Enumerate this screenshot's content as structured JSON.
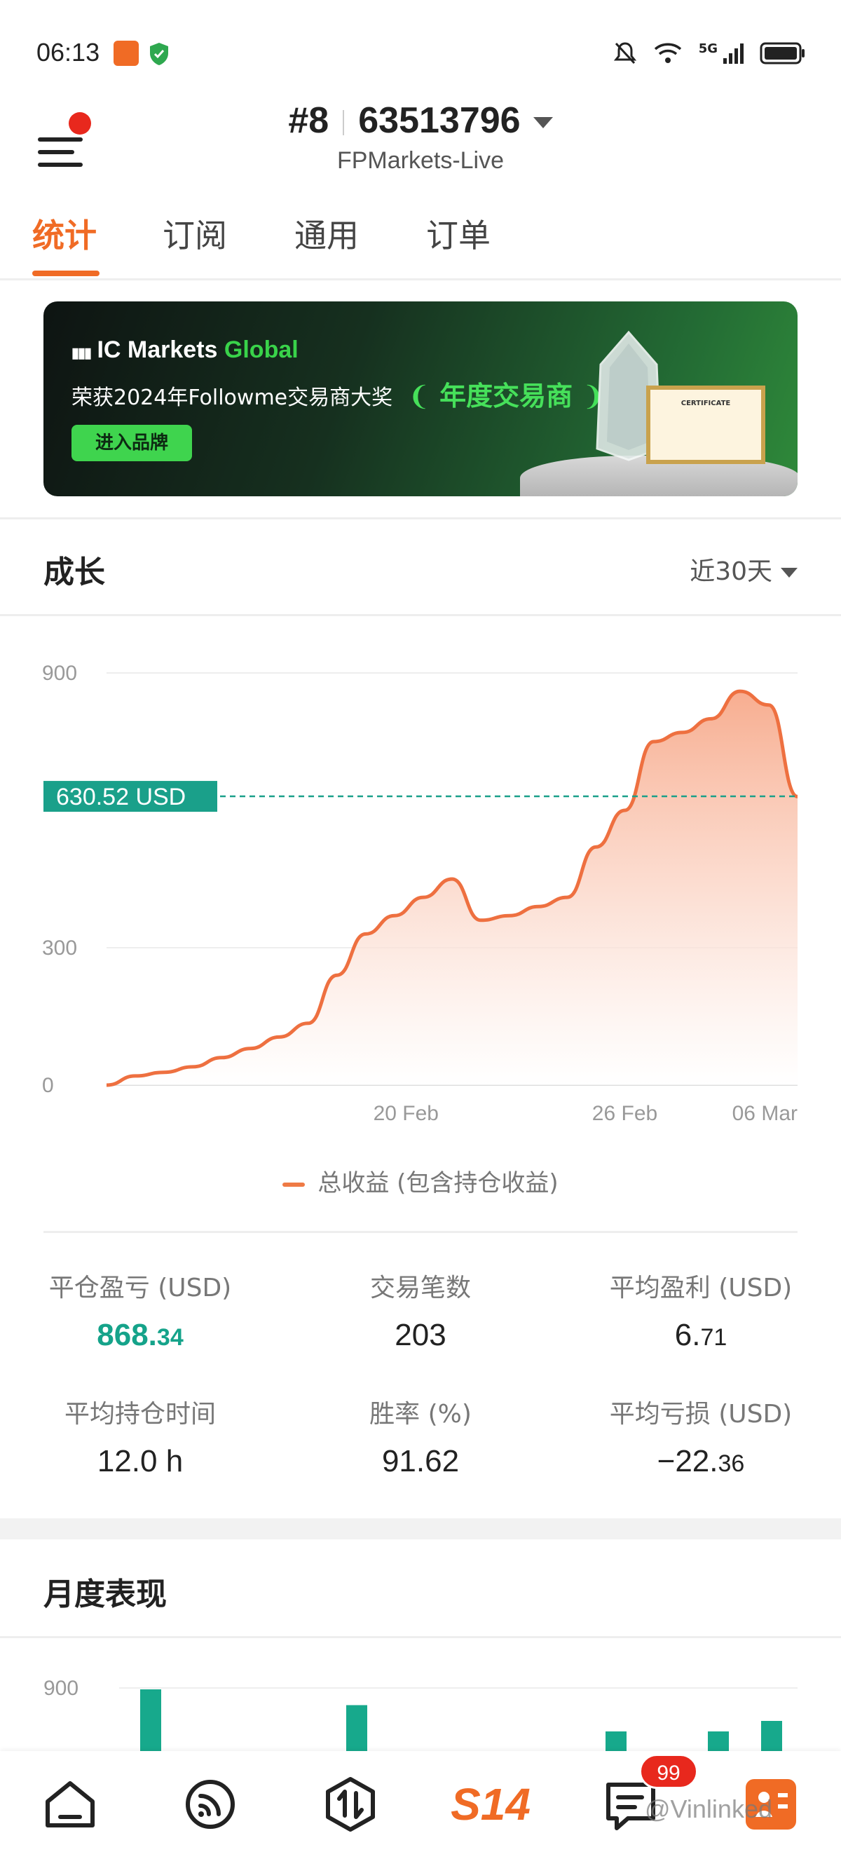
{
  "status_bar": {
    "time": "06:13",
    "network": "5G"
  },
  "header": {
    "rank": "#8",
    "account_id": "63513796",
    "server": "FPMarkets-Live"
  },
  "tabs": [
    {
      "label": "统计",
      "active": true
    },
    {
      "label": "订阅",
      "active": false
    },
    {
      "label": "通用",
      "active": false
    },
    {
      "label": "订单",
      "active": false
    }
  ],
  "banner": {
    "logo_prefix": "IC Markets",
    "logo_suffix": "Global",
    "text": "荣获2024年Followme交易商大奖",
    "award": "年度交易商",
    "button": "进入品牌",
    "certificate_title": "CERTIFICATE"
  },
  "growth": {
    "title": "成长",
    "range": "近30天",
    "current_label": "630.52 USD",
    "legend": "总收益 (包含持仓收益)"
  },
  "chart_data": {
    "type": "area",
    "x_ticks": [
      "20 Feb",
      "26 Feb",
      "06 Mar"
    ],
    "y_ticks": [
      0,
      300,
      900
    ],
    "ylim": [
      0,
      900
    ],
    "reference_line": 630.52,
    "series": [
      {
        "name": "总收益 (包含持仓收益)",
        "x": [
          0,
          1,
          2,
          3,
          4,
          5,
          6,
          7,
          8,
          9,
          10,
          11,
          12,
          13,
          14,
          15,
          16,
          17,
          18,
          19,
          20,
          21,
          22,
          23,
          24
        ],
        "values": [
          0,
          20,
          28,
          40,
          60,
          80,
          105,
          135,
          240,
          330,
          370,
          410,
          450,
          360,
          370,
          390,
          410,
          520,
          600,
          750,
          770,
          800,
          860,
          830,
          630
        ]
      }
    ],
    "grid": true,
    "colors": {
      "line": "#ee7040",
      "fill_top": "#f7a98a",
      "fill_bottom": "#ffffff",
      "ref": "#1aa08a"
    }
  },
  "stats": [
    {
      "label": "平仓盈亏 (USD)",
      "int": "868.",
      "dec": "34",
      "green": true
    },
    {
      "label": "交易笔数",
      "int": "203",
      "dec": "",
      "green": false
    },
    {
      "label": "平均盈利 (USD)",
      "int": "6.",
      "dec": "71",
      "green": false
    },
    {
      "label": "平均持仓时间",
      "int": "12.0 h",
      "dec": "",
      "green": false
    },
    {
      "label": "胜率 (%)",
      "int": "91.62",
      "dec": "",
      "green": false
    },
    {
      "label": "平均亏损 (USD)",
      "int": "−22.",
      "dec": "36",
      "green": false
    }
  ],
  "monthly": {
    "title": "月度表现",
    "y_tick": "900",
    "bars": [
      0.6,
      0.45,
      0.2,
      0.2,
      0.3
    ]
  },
  "bottom_nav": {
    "items": [
      "home-icon",
      "feed-icon",
      "trade-icon",
      "s14-logo",
      "messages-icon",
      "profile-icon"
    ],
    "logo_text": "S14",
    "badge": "99",
    "watermark": "@Vinlinked"
  }
}
